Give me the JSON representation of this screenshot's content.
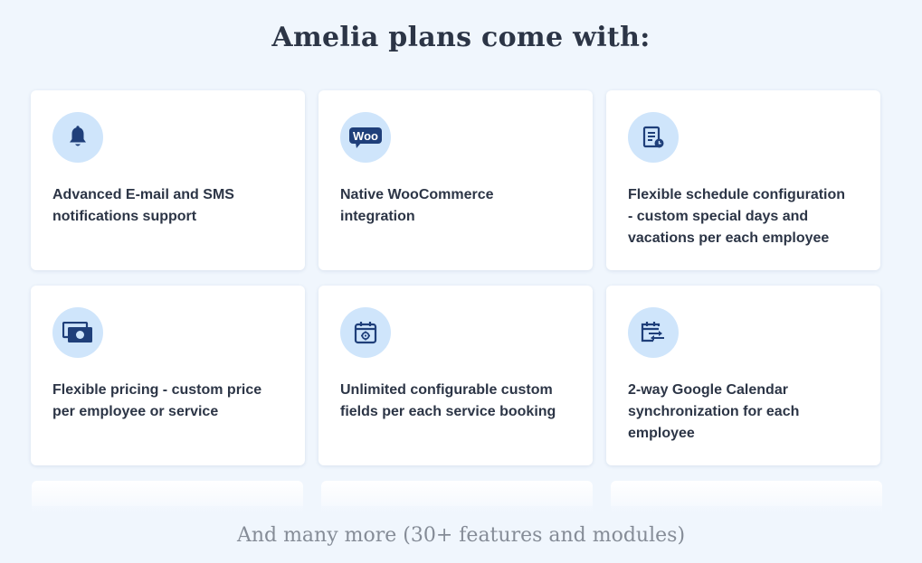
{
  "section": {
    "title": "Amelia plans come with:",
    "footer": "And many more (30+ features and modules)"
  },
  "colors": {
    "background": "#f0f6fd",
    "card": "#ffffff",
    "icon_circle": "#cfe5fb",
    "icon": "#1f3f7a",
    "text": "#2c3546",
    "muted": "#858c97"
  },
  "features": [
    {
      "icon": "bell-icon",
      "label": "Advanced E-mail and SMS notifications support"
    },
    {
      "icon": "woocommerce-icon",
      "icon_text": "Woo",
      "label": "Native WooCommerce integration"
    },
    {
      "icon": "schedule-document-icon",
      "label": "Flexible schedule configuration - custom special days and vacations per each employee"
    },
    {
      "icon": "cash-icon",
      "label": "Flexible pricing - custom price per employee or service"
    },
    {
      "icon": "calendar-gear-icon",
      "label": "Unlimited configurable custom fields per each service booking"
    },
    {
      "icon": "calendar-sync-icon",
      "label": "2-way Google Calendar synchronization for each employee"
    }
  ]
}
